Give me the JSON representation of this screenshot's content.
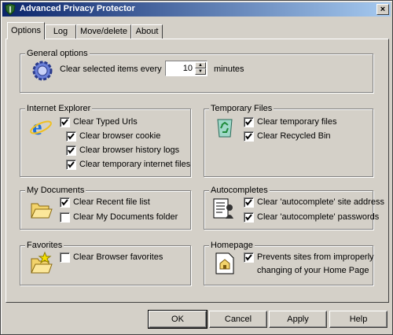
{
  "window": {
    "title": "Advanced Privacy Protector"
  },
  "tabs": [
    {
      "label": "Options",
      "active": true
    },
    {
      "label": "Log",
      "active": false
    },
    {
      "label": "Move/delete",
      "active": false
    },
    {
      "label": "About",
      "active": false
    }
  ],
  "general": {
    "title": "General options",
    "clear_label": "Clear selected items every",
    "interval_value": "10",
    "unit": "minutes"
  },
  "ie": {
    "title": "Internet Explorer",
    "items": [
      {
        "label": "Clear Typed Urls",
        "checked": true
      },
      {
        "label": "Clear browser cookie",
        "checked": true
      },
      {
        "label": "Clear browser history logs",
        "checked": true
      },
      {
        "label": "Clear temporary internet files",
        "checked": true
      }
    ]
  },
  "temp": {
    "title": "Temporary Files",
    "items": [
      {
        "label": "Clear temporary files",
        "checked": true
      },
      {
        "label": "Clear Recycled Bin",
        "checked": true
      }
    ]
  },
  "mydocs": {
    "title": "My Documents",
    "items": [
      {
        "label": "Clear Recent file list",
        "checked": true
      },
      {
        "label": "Clear My Documents folder",
        "checked": false
      }
    ]
  },
  "autocomplete": {
    "title": "Autocompletes",
    "items": [
      {
        "label": "Clear 'autocomplete' site address",
        "checked": true
      },
      {
        "label": "Clear 'autocomplete' passwords",
        "checked": true
      }
    ]
  },
  "favorites": {
    "title": "Favorites",
    "items": [
      {
        "label": "Clear Browser favorites",
        "checked": false
      }
    ]
  },
  "homepage": {
    "title": "Homepage",
    "items": [
      {
        "label_line1": "Prevents sites from improperly",
        "label_line2": "changing of your Home Page",
        "checked": true
      }
    ]
  },
  "buttons": {
    "ok": "OK",
    "cancel": "Cancel",
    "apply": "Apply",
    "help": "Help"
  },
  "colors": {
    "title_start": "#0a246a",
    "title_end": "#a6caf0",
    "face": "#d4d0c8"
  }
}
